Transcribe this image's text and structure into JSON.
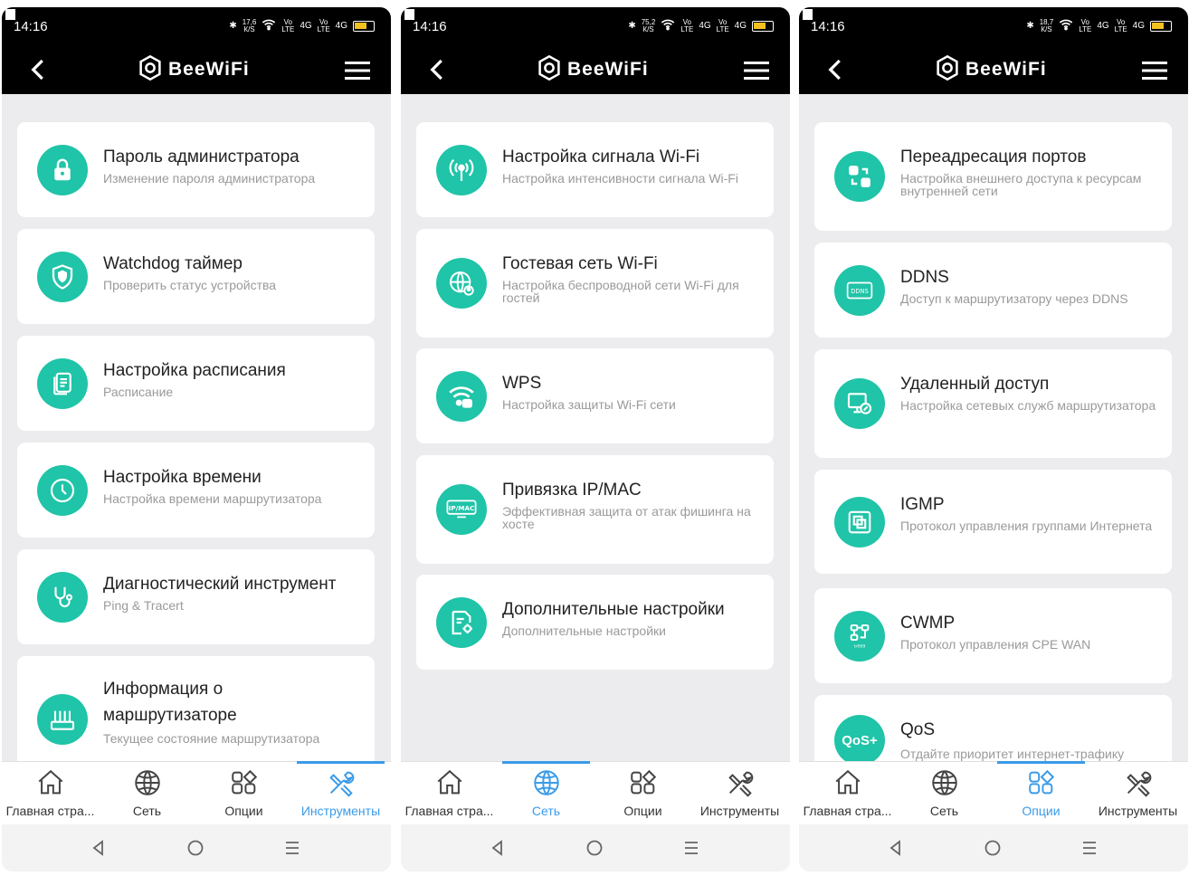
{
  "app": {
    "brand": "BeeWiFi",
    "accent": "#20c4a8",
    "active_tab": "#3b9be8"
  },
  "tabs": [
    "Главная стра...",
    "Сеть",
    "Опции",
    "Инструменты"
  ],
  "screens": [
    {
      "status": {
        "time": "14:16",
        "speed_top": "17,6",
        "speed_bottom": "К/S",
        "net1": "4G",
        "net2": "Vo LTE"
      },
      "active_tab_index": 3,
      "cards": [
        {
          "icon": "lock-icon",
          "title": "Пароль администратора",
          "subtitle": "Изменение пароля администратора"
        },
        {
          "icon": "shield-icon",
          "title": "Watchdog таймер",
          "subtitle": "Проверить статус устройства"
        },
        {
          "icon": "schedule-doc-icon",
          "title": "Настройка расписания",
          "subtitle": "Расписание"
        },
        {
          "icon": "clock-icon",
          "title": "Настройка времени",
          "subtitle": "Настройка времени маршрутизатора"
        },
        {
          "icon": "stethoscope-icon",
          "title": "Диагностический инструмент",
          "subtitle": "Ping & Tracert"
        },
        {
          "icon": "router-icon",
          "title": "Информация о маршрутизаторе",
          "subtitle": "Текущее состояние маршрутизатора"
        }
      ]
    },
    {
      "status": {
        "time": "14:16",
        "speed_top": "75,2",
        "speed_bottom": "К/S",
        "net1": "4G",
        "net2": "Vo LTE"
      },
      "active_tab_index": 1,
      "cards": [
        {
          "icon": "antenna-icon",
          "title": "Настройка сигнала Wi-Fi",
          "subtitle": "Настройка интенсивности сигнала Wi-Fi"
        },
        {
          "icon": "globe-user-icon",
          "title": "Гостевая сеть Wi-Fi",
          "subtitle": "Настройка беспроводной сети Wi-Fi для гостей"
        },
        {
          "icon": "wifi-lock-icon",
          "title": "WPS",
          "subtitle": "Настройка защиты Wi-Fi сети"
        },
        {
          "icon": "ip-mac-icon",
          "title": "Привязка IP/MAC",
          "subtitle": "Эффективная защита от атак фишинга на хосте"
        },
        {
          "icon": "settings-doc-icon",
          "title": "Дополнительные настройки",
          "subtitle": "Дополнительные настройки"
        }
      ]
    },
    {
      "status": {
        "time": "14:16",
        "speed_top": "18,7",
        "speed_bottom": "К/S",
        "net1": "4G",
        "net2": "Vo LTE"
      },
      "active_tab_index": 2,
      "cards": [
        {
          "icon": "port-forward-icon",
          "title": "Переадресация портов",
          "subtitle": "Настройка внешнего доступа к ресурсам внутренней сети"
        },
        {
          "icon": "ddns-icon",
          "title": "DDNS",
          "subtitle": "Доступ к маршрутизатору через DDNS"
        },
        {
          "icon": "remote-access-icon",
          "title": "Удаленный доступ",
          "subtitle": "Настройка сетевых служб маршрутизатора"
        },
        {
          "icon": "igmp-icon",
          "title": "IGMP",
          "subtitle": "Протокол управления группами Интернета"
        },
        {
          "icon": "cwmp-icon",
          "title": "CWMP",
          "subtitle": "Протокол управления CPE WAN"
        },
        {
          "icon": "qos-icon",
          "title": "QoS",
          "subtitle": "Отдайте приоритет интернет-трафику определенных устройств, чтобы"
        }
      ]
    }
  ]
}
